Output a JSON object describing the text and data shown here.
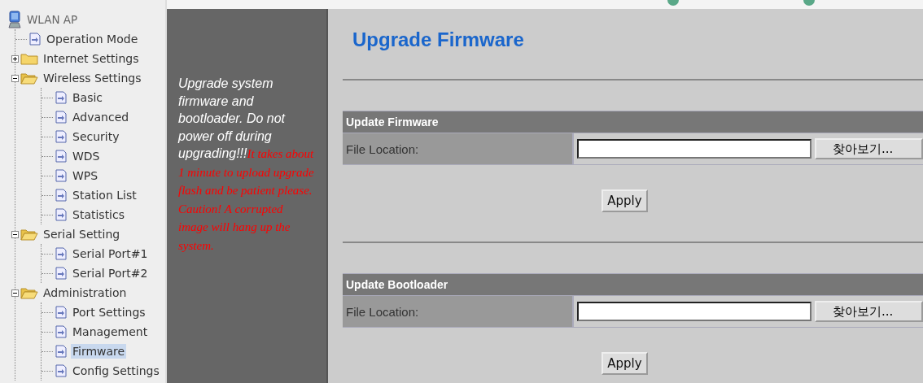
{
  "tree": {
    "label": "WLAN AP",
    "children": [
      {
        "label": "Operation Mode",
        "kind": "page",
        "selected": false
      },
      {
        "label": "Internet Settings",
        "kind": "folder",
        "expanded": false,
        "selected": false
      },
      {
        "label": "Wireless Settings",
        "kind": "folder",
        "expanded": true,
        "selected": false,
        "children": [
          {
            "label": "Basic",
            "kind": "page",
            "selected": false
          },
          {
            "label": "Advanced",
            "kind": "page",
            "selected": false
          },
          {
            "label": "Security",
            "kind": "page",
            "selected": false
          },
          {
            "label": "WDS",
            "kind": "page",
            "selected": false
          },
          {
            "label": "WPS",
            "kind": "page",
            "selected": false
          },
          {
            "label": "Station List",
            "kind": "page",
            "selected": false
          },
          {
            "label": "Statistics",
            "kind": "page",
            "selected": false
          }
        ]
      },
      {
        "label": "Serial Setting",
        "kind": "folder",
        "expanded": true,
        "selected": false,
        "children": [
          {
            "label": "Serial Port#1",
            "kind": "page",
            "selected": false
          },
          {
            "label": "Serial Port#2",
            "kind": "page",
            "selected": false
          }
        ]
      },
      {
        "label": "Administration",
        "kind": "folder",
        "expanded": true,
        "selected": false,
        "children": [
          {
            "label": "Port Settings",
            "kind": "page",
            "selected": false
          },
          {
            "label": "Management",
            "kind": "page",
            "selected": false
          },
          {
            "label": "Firmware",
            "kind": "page",
            "selected": true
          },
          {
            "label": "Config Settings",
            "kind": "page",
            "selected": false
          }
        ]
      }
    ]
  },
  "help": {
    "note": "Upgrade system firmware and bootloader. Do not power off during upgrading!!!",
    "warning": "It takes about 1 minute to upload  upgrade flash and be patient please. Caution! A corrupted image will hang up the system."
  },
  "page_title": "Upgrade Firmware",
  "sections": [
    {
      "title": "Update Firmware",
      "label": "File Location:",
      "browse_button": "찾아보기...",
      "apply_button": "Apply"
    },
    {
      "title": "Update Bootloader",
      "label": "File Location:",
      "browse_button": "찾아보기...",
      "apply_button": "Apply"
    }
  ]
}
